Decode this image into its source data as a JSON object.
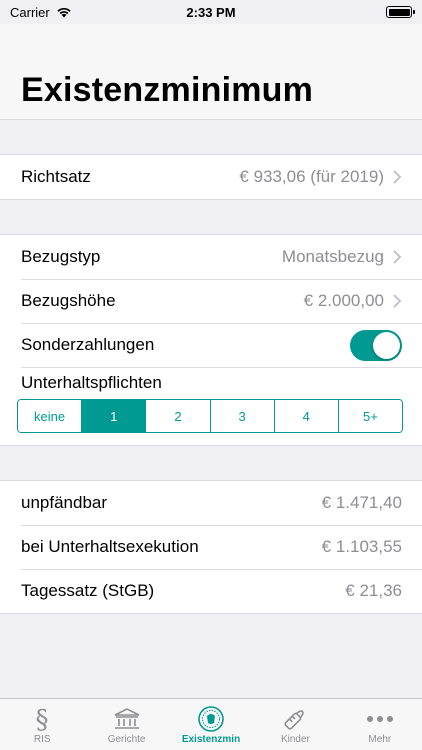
{
  "status": {
    "carrier": "Carrier",
    "time": "2:33 PM"
  },
  "header": {
    "title": "Existenzminimum"
  },
  "rate": {
    "label": "Richtsatz",
    "value": "€ 933,06 (für 2019)"
  },
  "settings": {
    "type_label": "Bezugstyp",
    "type_value": "Monatsbezug",
    "amount_label": "Bezugshöhe",
    "amount_value": "€ 2.000,00",
    "extras_label": "Sonderzahlungen",
    "extras_on": true,
    "obligations_label": "Unterhaltspflichten",
    "obligations_options": [
      "keine",
      "1",
      "2",
      "3",
      "4",
      "5+"
    ],
    "obligations_selected": "1"
  },
  "results": [
    {
      "label": "unpfändbar",
      "value": "€ 1.471,40"
    },
    {
      "label": "bei Unterhaltsexekution",
      "value": "€ 1.103,55"
    },
    {
      "label": "Tagessatz (StGB)",
      "value": "€ 21,36"
    }
  ],
  "tabs": [
    {
      "label": "RIS",
      "icon": "paragraph-icon"
    },
    {
      "label": "Gerichte",
      "icon": "courthouse-icon"
    },
    {
      "label": "Existenzmin",
      "icon": "seal-icon"
    },
    {
      "label": "Kinder",
      "icon": "baby-bottle-icon"
    },
    {
      "label": "Mehr",
      "icon": "more-icon"
    }
  ],
  "colors": {
    "accent": "#009a93",
    "secondary_text": "#8e8e93",
    "background": "#efeff4"
  }
}
